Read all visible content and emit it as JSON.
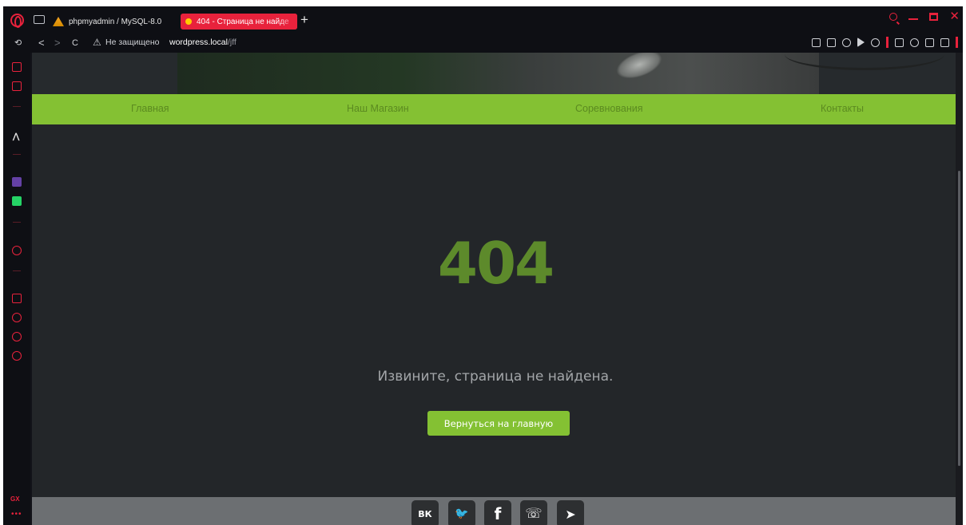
{
  "browser": {
    "tabs": [
      {
        "title": "phpmyadmin / MySQL-8.0"
      },
      {
        "title": "404 - Страница не найде"
      }
    ],
    "new_tab_symbol": "+",
    "address": {
      "warning_symbol": "⚠",
      "insecure_label": "Не защищено",
      "host": "wordpress.local",
      "path": "/jff"
    },
    "nav": {
      "back": "<",
      "forward": ">",
      "reload": "C"
    },
    "sidebar_bottom_label": "GX",
    "sidebar_dots": "•••",
    "accent_color": "#e8223c"
  },
  "site": {
    "nav_items": [
      "Главная",
      "Наш Магазин",
      "Соревнования",
      "Контакты"
    ],
    "error_code": "404",
    "error_message": "Извините, страница не найдена.",
    "home_button": "Вернуться на главную",
    "social": [
      {
        "name": "vk-icon",
        "glyph": "ВК"
      },
      {
        "name": "twitter-icon",
        "glyph": "🐦"
      },
      {
        "name": "facebook-icon",
        "glyph": "f"
      },
      {
        "name": "viber-icon",
        "glyph": "☏"
      },
      {
        "name": "telegram-icon",
        "glyph": "➤"
      }
    ],
    "colors": {
      "green": "#84c133",
      "dark_bg": "#232629",
      "code_green": "#5d8a2b",
      "footer": "#6c6f72"
    }
  }
}
